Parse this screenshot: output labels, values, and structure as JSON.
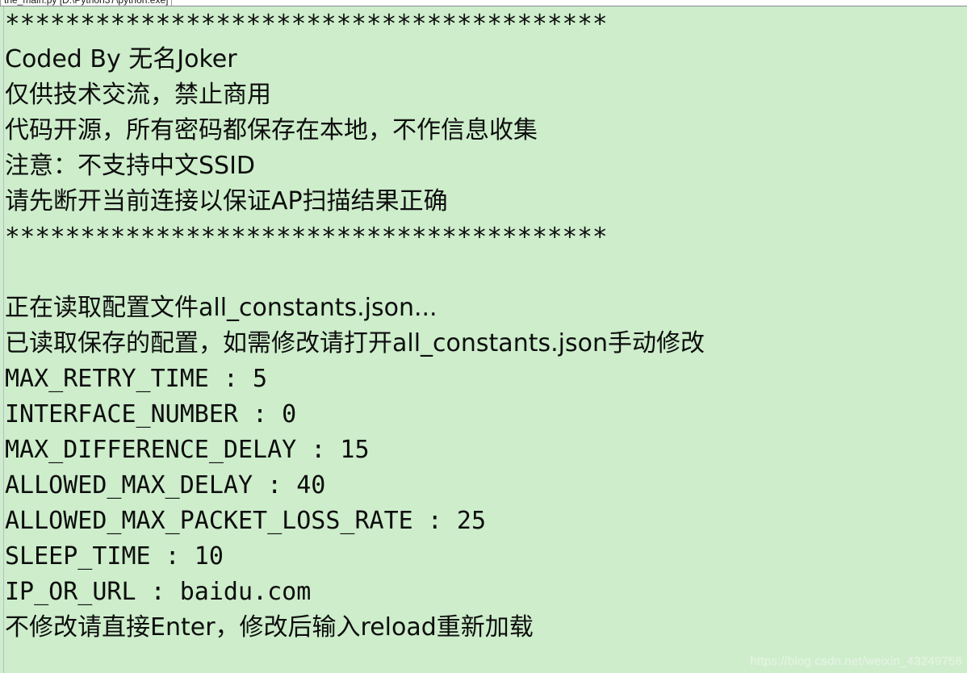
{
  "window": {
    "tab_title": "the_main.py [D:\\Python37\\python.exe]",
    "console_background": "#cdedcb",
    "text_color": "#0d0d0d"
  },
  "console": {
    "lines": [
      {
        "id": "banner-top-rule",
        "text": "****************************************"
      },
      {
        "id": "banner-author",
        "text": "Coded By 无名Joker"
      },
      {
        "id": "banner-notice-1",
        "text": "仅供技术交流，禁止商用"
      },
      {
        "id": "banner-notice-2",
        "text": "代码开源，所有密码都保存在本地，不作信息收集"
      },
      {
        "id": "banner-notice-3",
        "text": "注意：不支持中文SSID"
      },
      {
        "id": "banner-notice-4",
        "text": "请先断开当前连接以保证AP扫描结果正确"
      },
      {
        "id": "banner-bottom-rule",
        "text": "****************************************"
      },
      {
        "id": "blank-1",
        "text": ""
      },
      {
        "id": "config-reading",
        "text": "正在读取配置文件all_constants.json..."
      },
      {
        "id": "config-loaded",
        "text": "已读取保存的配置，如需修改请打开all_constants.json手动修改"
      },
      {
        "id": "cfg-max-retry-time",
        "text": "MAX_RETRY_TIME : 5"
      },
      {
        "id": "cfg-interface-number",
        "text": "INTERFACE_NUMBER : 0"
      },
      {
        "id": "cfg-max-diff-delay",
        "text": "MAX_DIFFERENCE_DELAY : 15"
      },
      {
        "id": "cfg-allowed-max-delay",
        "text": "ALLOWED_MAX_DELAY : 40"
      },
      {
        "id": "cfg-allowed-max-plr",
        "text": "ALLOWED_MAX_PACKET_LOSS_RATE : 25"
      },
      {
        "id": "cfg-sleep-time",
        "text": "SLEEP_TIME : 10"
      },
      {
        "id": "cfg-ip-or-url",
        "text": "IP_OR_URL : baidu.com"
      },
      {
        "id": "prompt-reload",
        "text": "不修改请直接Enter，修改后输入reload重新加载"
      }
    ],
    "config_values": {
      "MAX_RETRY_TIME": "5",
      "INTERFACE_NUMBER": "0",
      "MAX_DIFFERENCE_DELAY": "15",
      "ALLOWED_MAX_DELAY": "40",
      "ALLOWED_MAX_PACKET_LOSS_RATE": "25",
      "SLEEP_TIME": "10",
      "IP_OR_URL": "baidu.com"
    },
    "config_file_name": "all_constants.json"
  },
  "watermark": {
    "text": "https://blog.csdn.net/weixin_43249758"
  }
}
